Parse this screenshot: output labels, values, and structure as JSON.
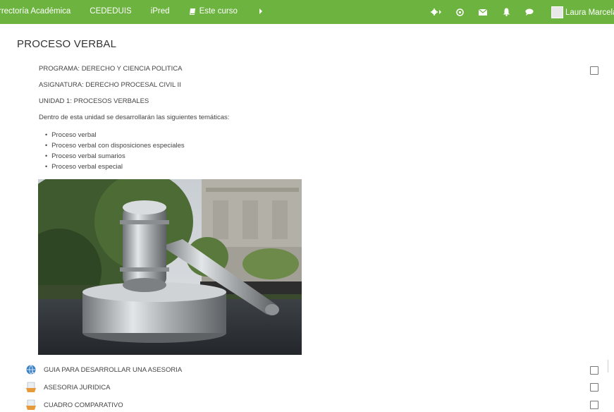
{
  "topbar": {
    "nav": [
      "rrectoría Académica",
      "CEDEDUIS",
      "iPred"
    ],
    "course_menu": "Este curso",
    "user_name": "Laura Marcela R",
    "icons": [
      "gear-icon",
      "plus-circle-icon",
      "envelope-icon",
      "bell-icon",
      "chat-icon"
    ],
    "bg_color": "#6cb33f"
  },
  "section": {
    "title": "PROCESO VERBAL",
    "programa": "PROGRAMA: DERECHO Y CIENCIA POLITICA",
    "asignatura": "ASIGNATURA: DERECHO PROCESAL CIVIL II",
    "unidad": "UNIDAD 1: PROCESOS VERBALES",
    "intro": "Dentro de esta unidad se desarrollarán las siguientes temáticas:",
    "topics": [
      "Proceso verbal",
      "Proceso verbal con disposiciones especiales",
      "Proceso verbal sumarios",
      "Proceso verbal especial"
    ],
    "image_icon": "gavel-sculpture-photo"
  },
  "activities": [
    {
      "label": "GUIA PARA DESARROLLAR UNA ASESORIA",
      "icon": "web-link-icon"
    },
    {
      "label": "ASESORIA JURIDICA",
      "icon": "assignment-icon"
    },
    {
      "label": "CUADRO COMPARATIVO",
      "icon": "assignment-icon"
    }
  ]
}
